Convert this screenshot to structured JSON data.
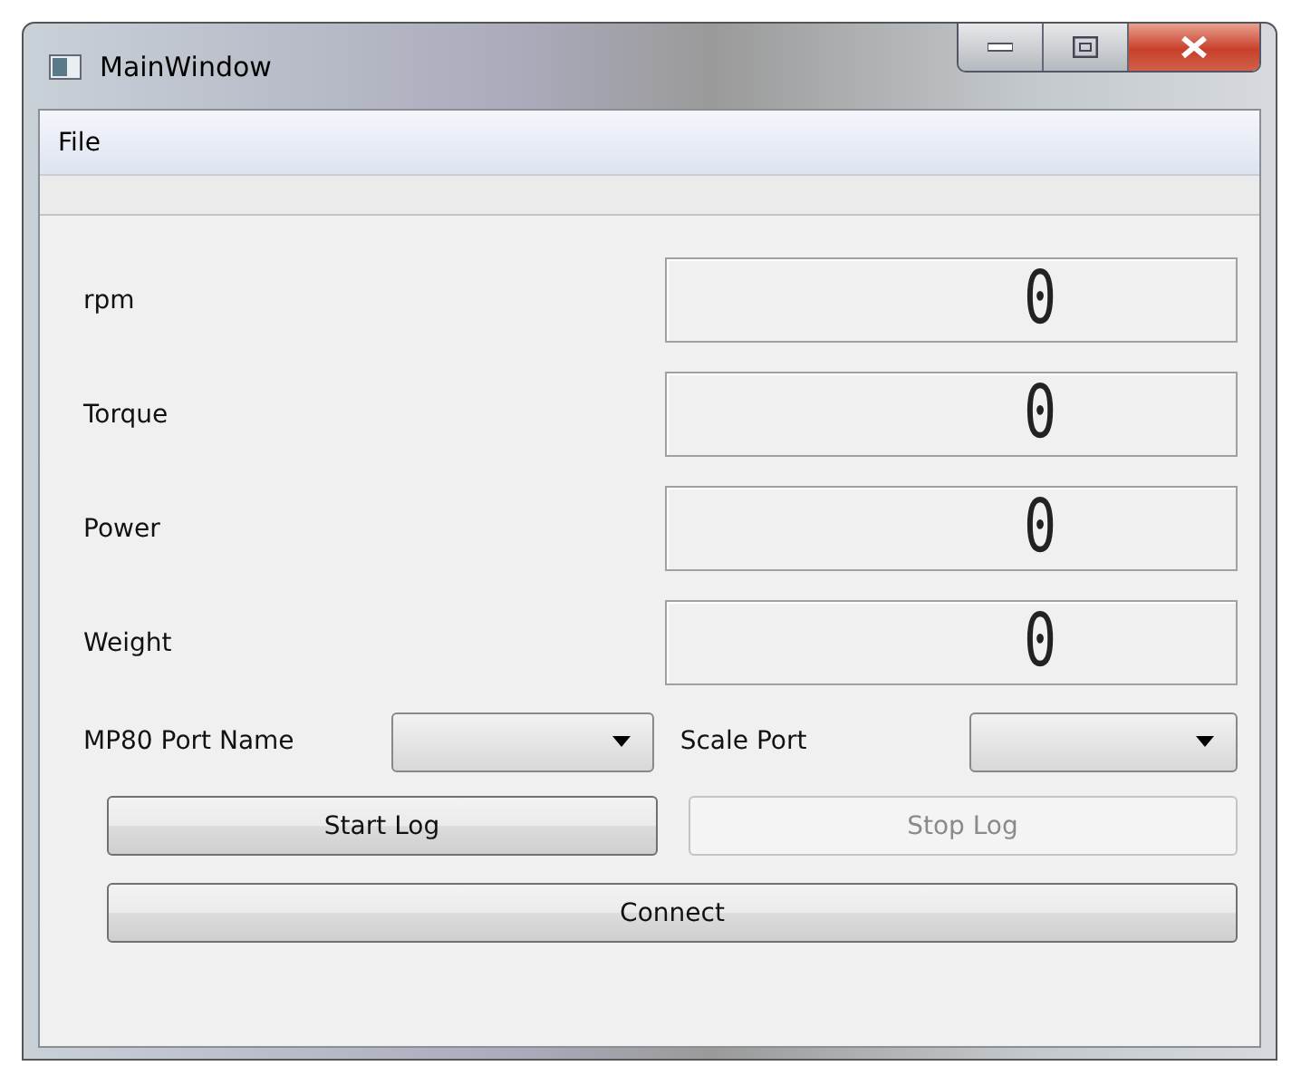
{
  "window": {
    "title": "MainWindow"
  },
  "menu": [
    "File"
  ],
  "readings": [
    {
      "label": "rpm",
      "value": "0"
    },
    {
      "label": "Torque",
      "value": "0"
    },
    {
      "label": "Power",
      "value": "0"
    },
    {
      "label": "Weight",
      "value": "0"
    }
  ],
  "ports": [
    {
      "label": "MP80 Port Name"
    },
    {
      "label": "Scale Port"
    }
  ],
  "buttons": [
    {
      "label": "Start Log",
      "disabled": false
    },
    {
      "label": "Stop Log",
      "disabled": true
    }
  ],
  "connect": {
    "label": "Connect",
    "disabled": false
  }
}
